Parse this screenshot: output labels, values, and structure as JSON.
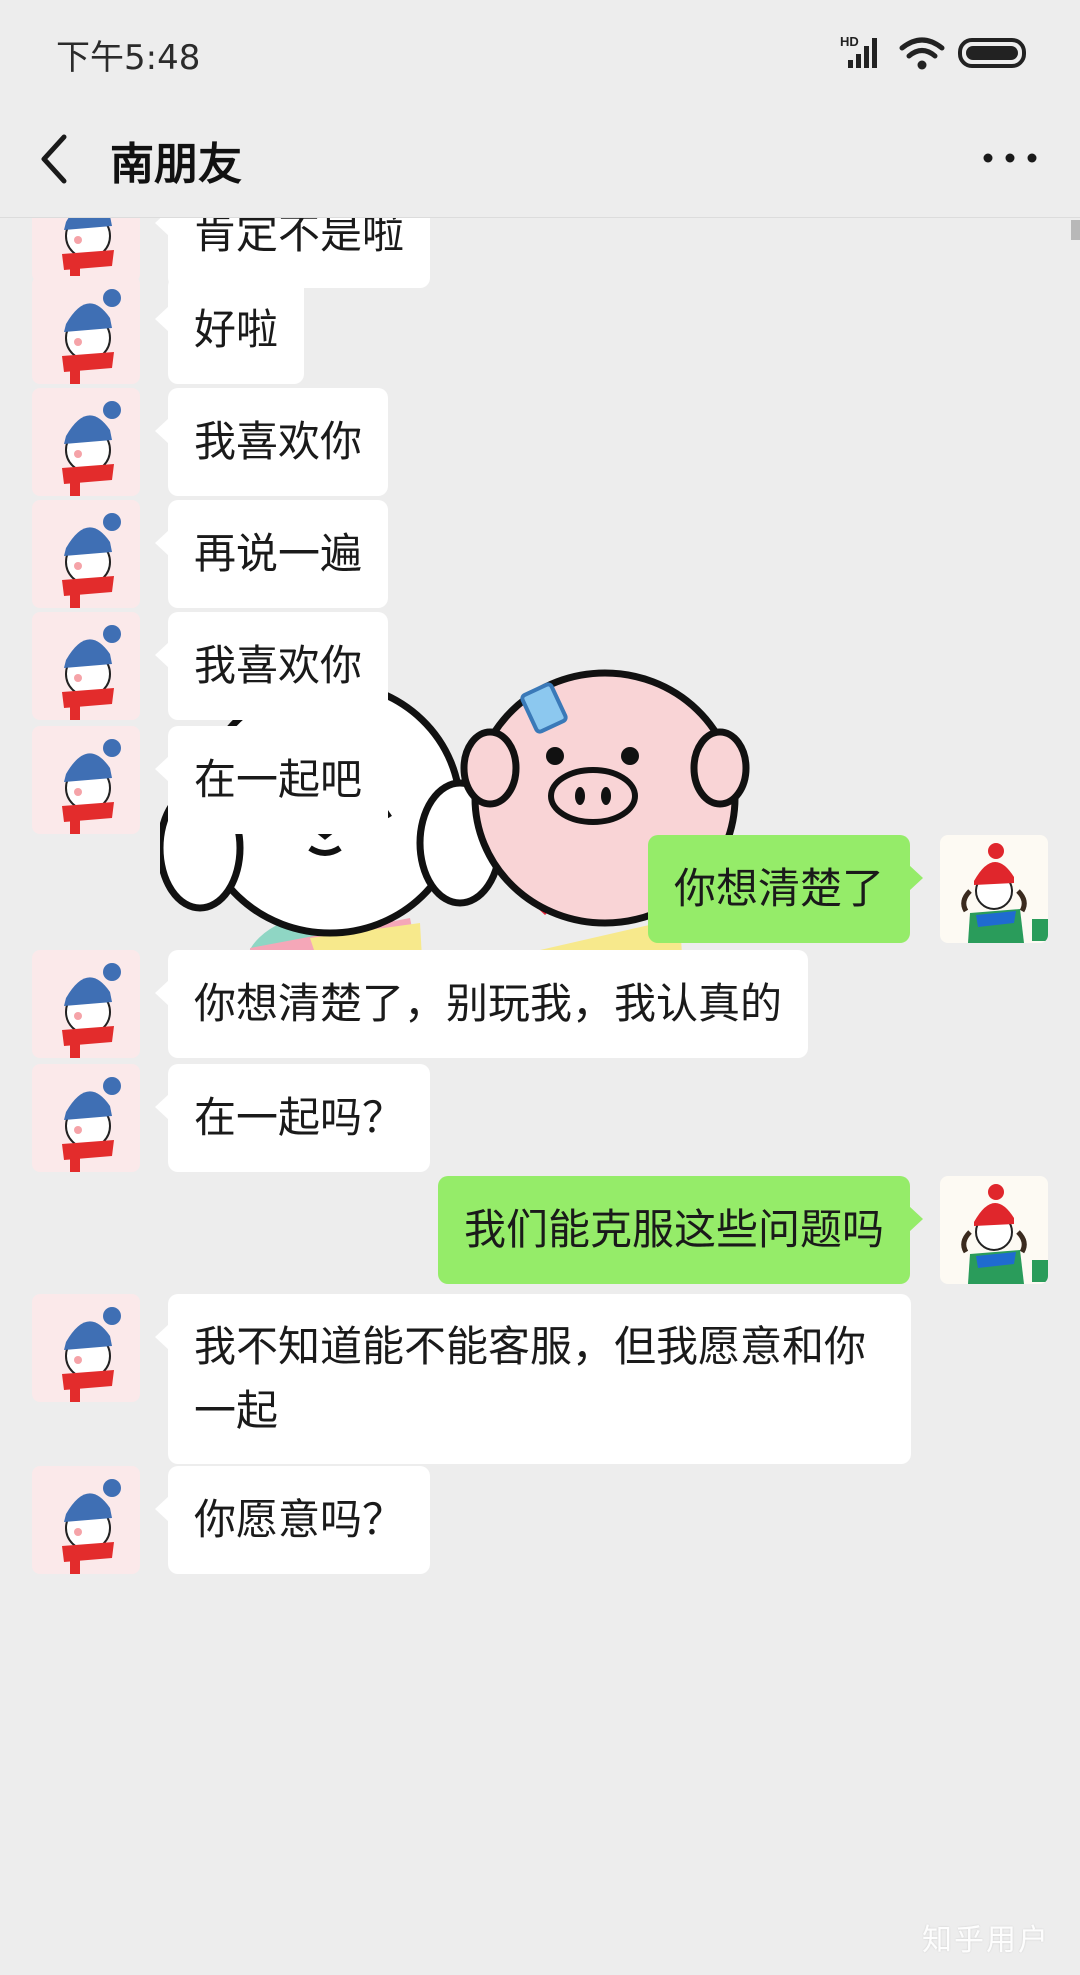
{
  "status_bar": {
    "time": "下午5:48",
    "network_label": "HD",
    "icons": [
      "signal-icon",
      "wifi-icon",
      "battery-icon"
    ]
  },
  "header": {
    "title": "南朋友",
    "back_icon": "chevron-left-icon",
    "more_icon": "more-dots-icon"
  },
  "messages": [
    {
      "side": "in",
      "text": "肯定不是啦"
    },
    {
      "side": "in",
      "text": "好啦"
    },
    {
      "side": "in",
      "text": "我喜欢你"
    },
    {
      "side": "in",
      "text": "再说一遍"
    },
    {
      "side": "in",
      "text": "我喜欢你"
    },
    {
      "side": "in",
      "text": "在一起吧"
    },
    {
      "side": "out",
      "text": "你想清楚了"
    },
    {
      "side": "in",
      "text": "你想清楚了，别玩我，我认真的"
    },
    {
      "side": "in",
      "text": "在一起吗？"
    },
    {
      "side": "out",
      "text": "我们能克服这些问题吗"
    },
    {
      "side": "in",
      "text": "我不知道能不能客服，但我愿意和你一起"
    },
    {
      "side": "in",
      "text": "你愿意吗？"
    }
  ],
  "sticker": {
    "icon": "dog-and-pig-sticker-icon"
  },
  "colors": {
    "background": "#ededed",
    "incoming_bubble": "#ffffff",
    "outgoing_bubble": "#95ec69"
  },
  "watermark": "知乎用户"
}
